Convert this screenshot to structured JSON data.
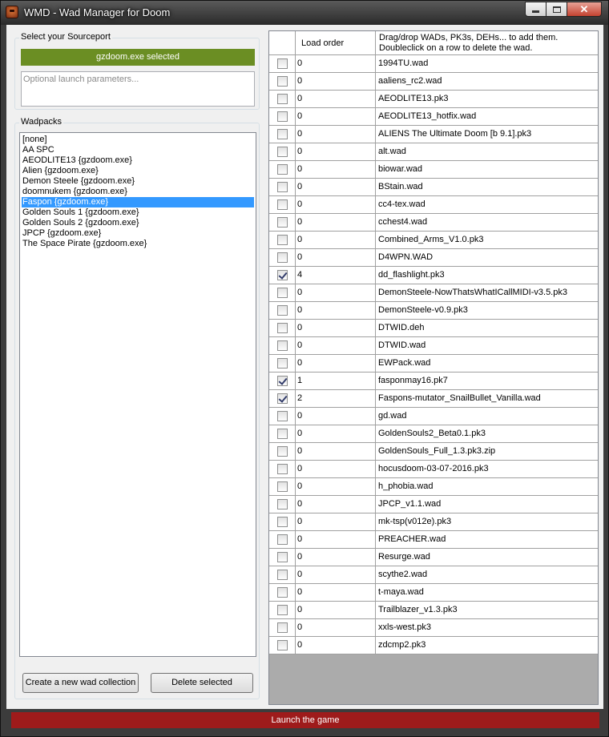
{
  "window": {
    "title": "WMD - Wad Manager for Doom",
    "accent": "#9e1b1b"
  },
  "sourceport": {
    "group_label": "Select your Sourceport",
    "selected_label": "gzdoom.exe selected",
    "selected_color": "#6b8e23",
    "params_placeholder": "Optional launch parameters..."
  },
  "wadpacks": {
    "group_label": "Wadpacks",
    "items": [
      "[none]",
      "AA SPC",
      "AEODLITE13 {gzdoom.exe}",
      "Alien {gzdoom.exe}",
      "Demon Steele {gzdoom.exe}",
      "doomnukem {gzdoom.exe}",
      "Faspon {gzdoom.exe}",
      "Golden Souls 1 {gzdoom.exe}",
      "Golden Souls 2 {gzdoom.exe}",
      "JPCP {gzdoom.exe}",
      "The Space Pirate {gzdoom.exe}"
    ],
    "selected_item": "Faspon {gzdoom.exe}",
    "create_button": "Create a new wad collection",
    "delete_button": "Delete selected"
  },
  "grid": {
    "col_order": "Load order",
    "col_file_line1": "Drag/drop WADs, PK3s, DEHs... to add them.",
    "col_file_line2": "Doubleclick on a row to delete the wad.",
    "rows": [
      {
        "checked": false,
        "order": "0",
        "file": "1994TU.wad"
      },
      {
        "checked": false,
        "order": "0",
        "file": "aaliens_rc2.wad"
      },
      {
        "checked": false,
        "order": "0",
        "file": "AEODLITE13.pk3"
      },
      {
        "checked": false,
        "order": "0",
        "file": "AEODLITE13_hotfix.wad"
      },
      {
        "checked": false,
        "order": "0",
        "file": "ALIENS The Ultimate Doom [b 9.1].pk3"
      },
      {
        "checked": false,
        "order": "0",
        "file": "alt.wad"
      },
      {
        "checked": false,
        "order": "0",
        "file": "biowar.wad"
      },
      {
        "checked": false,
        "order": "0",
        "file": "BStain.wad"
      },
      {
        "checked": false,
        "order": "0",
        "file": "cc4-tex.wad"
      },
      {
        "checked": false,
        "order": "0",
        "file": "cchest4.wad"
      },
      {
        "checked": false,
        "order": "0",
        "file": "Combined_Arms_V1.0.pk3"
      },
      {
        "checked": false,
        "order": "0",
        "file": "D4WPN.WAD"
      },
      {
        "checked": true,
        "order": "4",
        "file": "dd_flashlight.pk3"
      },
      {
        "checked": false,
        "order": "0",
        "file": "DemonSteele-NowThatsWhatICallMIDI-v3.5.pk3"
      },
      {
        "checked": false,
        "order": "0",
        "file": "DemonSteele-v0.9.pk3"
      },
      {
        "checked": false,
        "order": "0",
        "file": "DTWID.deh"
      },
      {
        "checked": false,
        "order": "0",
        "file": "DTWID.wad"
      },
      {
        "checked": false,
        "order": "0",
        "file": "EWPack.wad"
      },
      {
        "checked": true,
        "order": "1",
        "file": "fasponmay16.pk7"
      },
      {
        "checked": true,
        "order": "2",
        "file": "Faspons-mutator_SnailBullet_Vanilla.wad"
      },
      {
        "checked": false,
        "order": "0",
        "file": "gd.wad"
      },
      {
        "checked": false,
        "order": "0",
        "file": "GoldenSouls2_Beta0.1.pk3"
      },
      {
        "checked": false,
        "order": "0",
        "file": "GoldenSouls_Full_1.3.pk3.zip"
      },
      {
        "checked": false,
        "order": "0",
        "file": "hocusdoom-03-07-2016.pk3"
      },
      {
        "checked": false,
        "order": "0",
        "file": "h_phobia.wad"
      },
      {
        "checked": false,
        "order": "0",
        "file": "JPCP_v1.1.wad"
      },
      {
        "checked": false,
        "order": "0",
        "file": "mk-tsp(v012e).pk3"
      },
      {
        "checked": false,
        "order": "0",
        "file": "PREACHER.wad"
      },
      {
        "checked": false,
        "order": "0",
        "file": "Resurge.wad"
      },
      {
        "checked": false,
        "order": "0",
        "file": "scythe2.wad"
      },
      {
        "checked": false,
        "order": "0",
        "file": "t-maya.wad"
      },
      {
        "checked": false,
        "order": "0",
        "file": "Trailblazer_v1.3.pk3"
      },
      {
        "checked": false,
        "order": "0",
        "file": "xxls-west.pk3"
      },
      {
        "checked": false,
        "order": "0",
        "file": "zdcmp2.pk3"
      }
    ]
  },
  "launch": {
    "label": "Launch the game"
  }
}
